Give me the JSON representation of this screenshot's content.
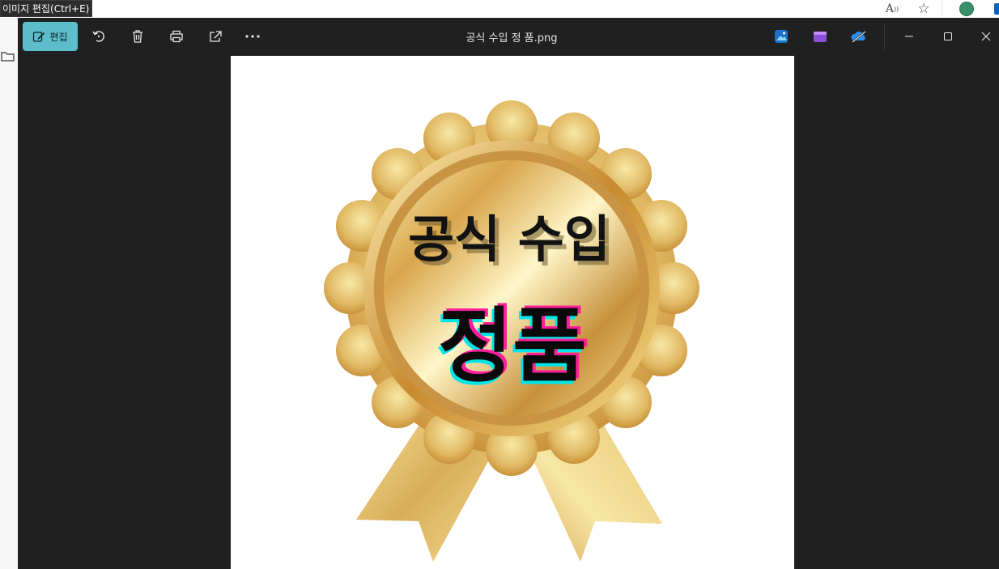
{
  "tooltip": {
    "text": "이미지 편집(Ctrl+E)"
  },
  "browser": {
    "read_aloud_icon": "read-aloud-icon",
    "favorite_icon": "star-icon",
    "extension_icon": "extension-icon"
  },
  "toolbar": {
    "edit_label": "편집",
    "icons": [
      "edit-icon",
      "rotate-icon",
      "trash-icon",
      "print-icon",
      "share-icon",
      "more-icon"
    ],
    "title": "공식 수입 정 품.png",
    "apps": [
      "photos-app-icon",
      "clipchamp-icon",
      "onedrive-icon"
    ]
  },
  "image": {
    "line1": "공식 수입",
    "line2": "정품"
  },
  "colors": {
    "accent": "#5dbdca",
    "background": "#202020",
    "gold_light": "#f6e6a0",
    "gold_dark": "#b07a2c"
  }
}
